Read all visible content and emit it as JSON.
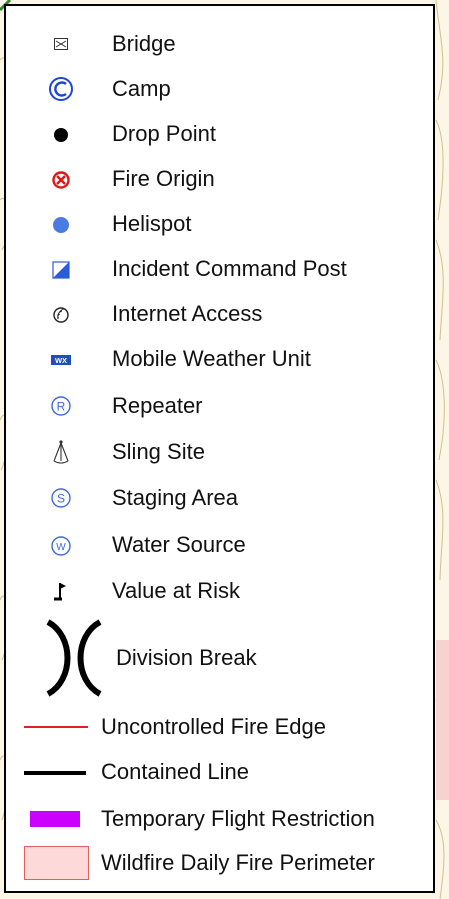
{
  "map": {
    "background_color": "#fbf6e6",
    "contour_color": "#c9b27a",
    "vegetation_color": "#2f8a2f",
    "perimeter_fill": "#f6d3cf"
  },
  "legend": {
    "items": [
      {
        "label": "Bridge",
        "icon": "bridge-icon"
      },
      {
        "label": "Camp",
        "icon": "camp-icon"
      },
      {
        "label": "Drop Point",
        "icon": "drop-point-icon"
      },
      {
        "label": "Fire Origin",
        "icon": "fire-origin-icon"
      },
      {
        "label": "Helispot",
        "icon": "helispot-icon"
      },
      {
        "label": "Incident Command Post",
        "icon": "incident-command-post-icon"
      },
      {
        "label": "Internet Access",
        "icon": "internet-access-icon"
      },
      {
        "label": "Mobile Weather Unit",
        "icon": "mobile-weather-unit-icon",
        "icon_text": "WX"
      },
      {
        "label": "Repeater",
        "icon": "repeater-icon",
        "icon_text": "R"
      },
      {
        "label": "Sling Site",
        "icon": "sling-site-icon"
      },
      {
        "label": "Staging Area",
        "icon": "staging-area-icon",
        "icon_text": "S"
      },
      {
        "label": "Water Source",
        "icon": "water-source-icon",
        "icon_text": "W"
      },
      {
        "label": "Value at Risk",
        "icon": "value-at-risk-icon"
      },
      {
        "label": "Division Break",
        "icon": "division-break-icon"
      },
      {
        "label": "Uncontrolled Fire Edge",
        "icon": "uncontrolled-fire-edge-line",
        "color": "#e02020"
      },
      {
        "label": "Contained Line",
        "icon": "contained-line",
        "color": "#000000"
      },
      {
        "label": "Temporary Flight Restriction",
        "icon": "temporary-flight-restriction-swatch",
        "color": "#cc00ff"
      },
      {
        "label": "Wildfire Daily Fire Perimeter",
        "icon": "wildfire-daily-fire-perimeter-swatch",
        "color": "#fdd9d9"
      }
    ]
  }
}
